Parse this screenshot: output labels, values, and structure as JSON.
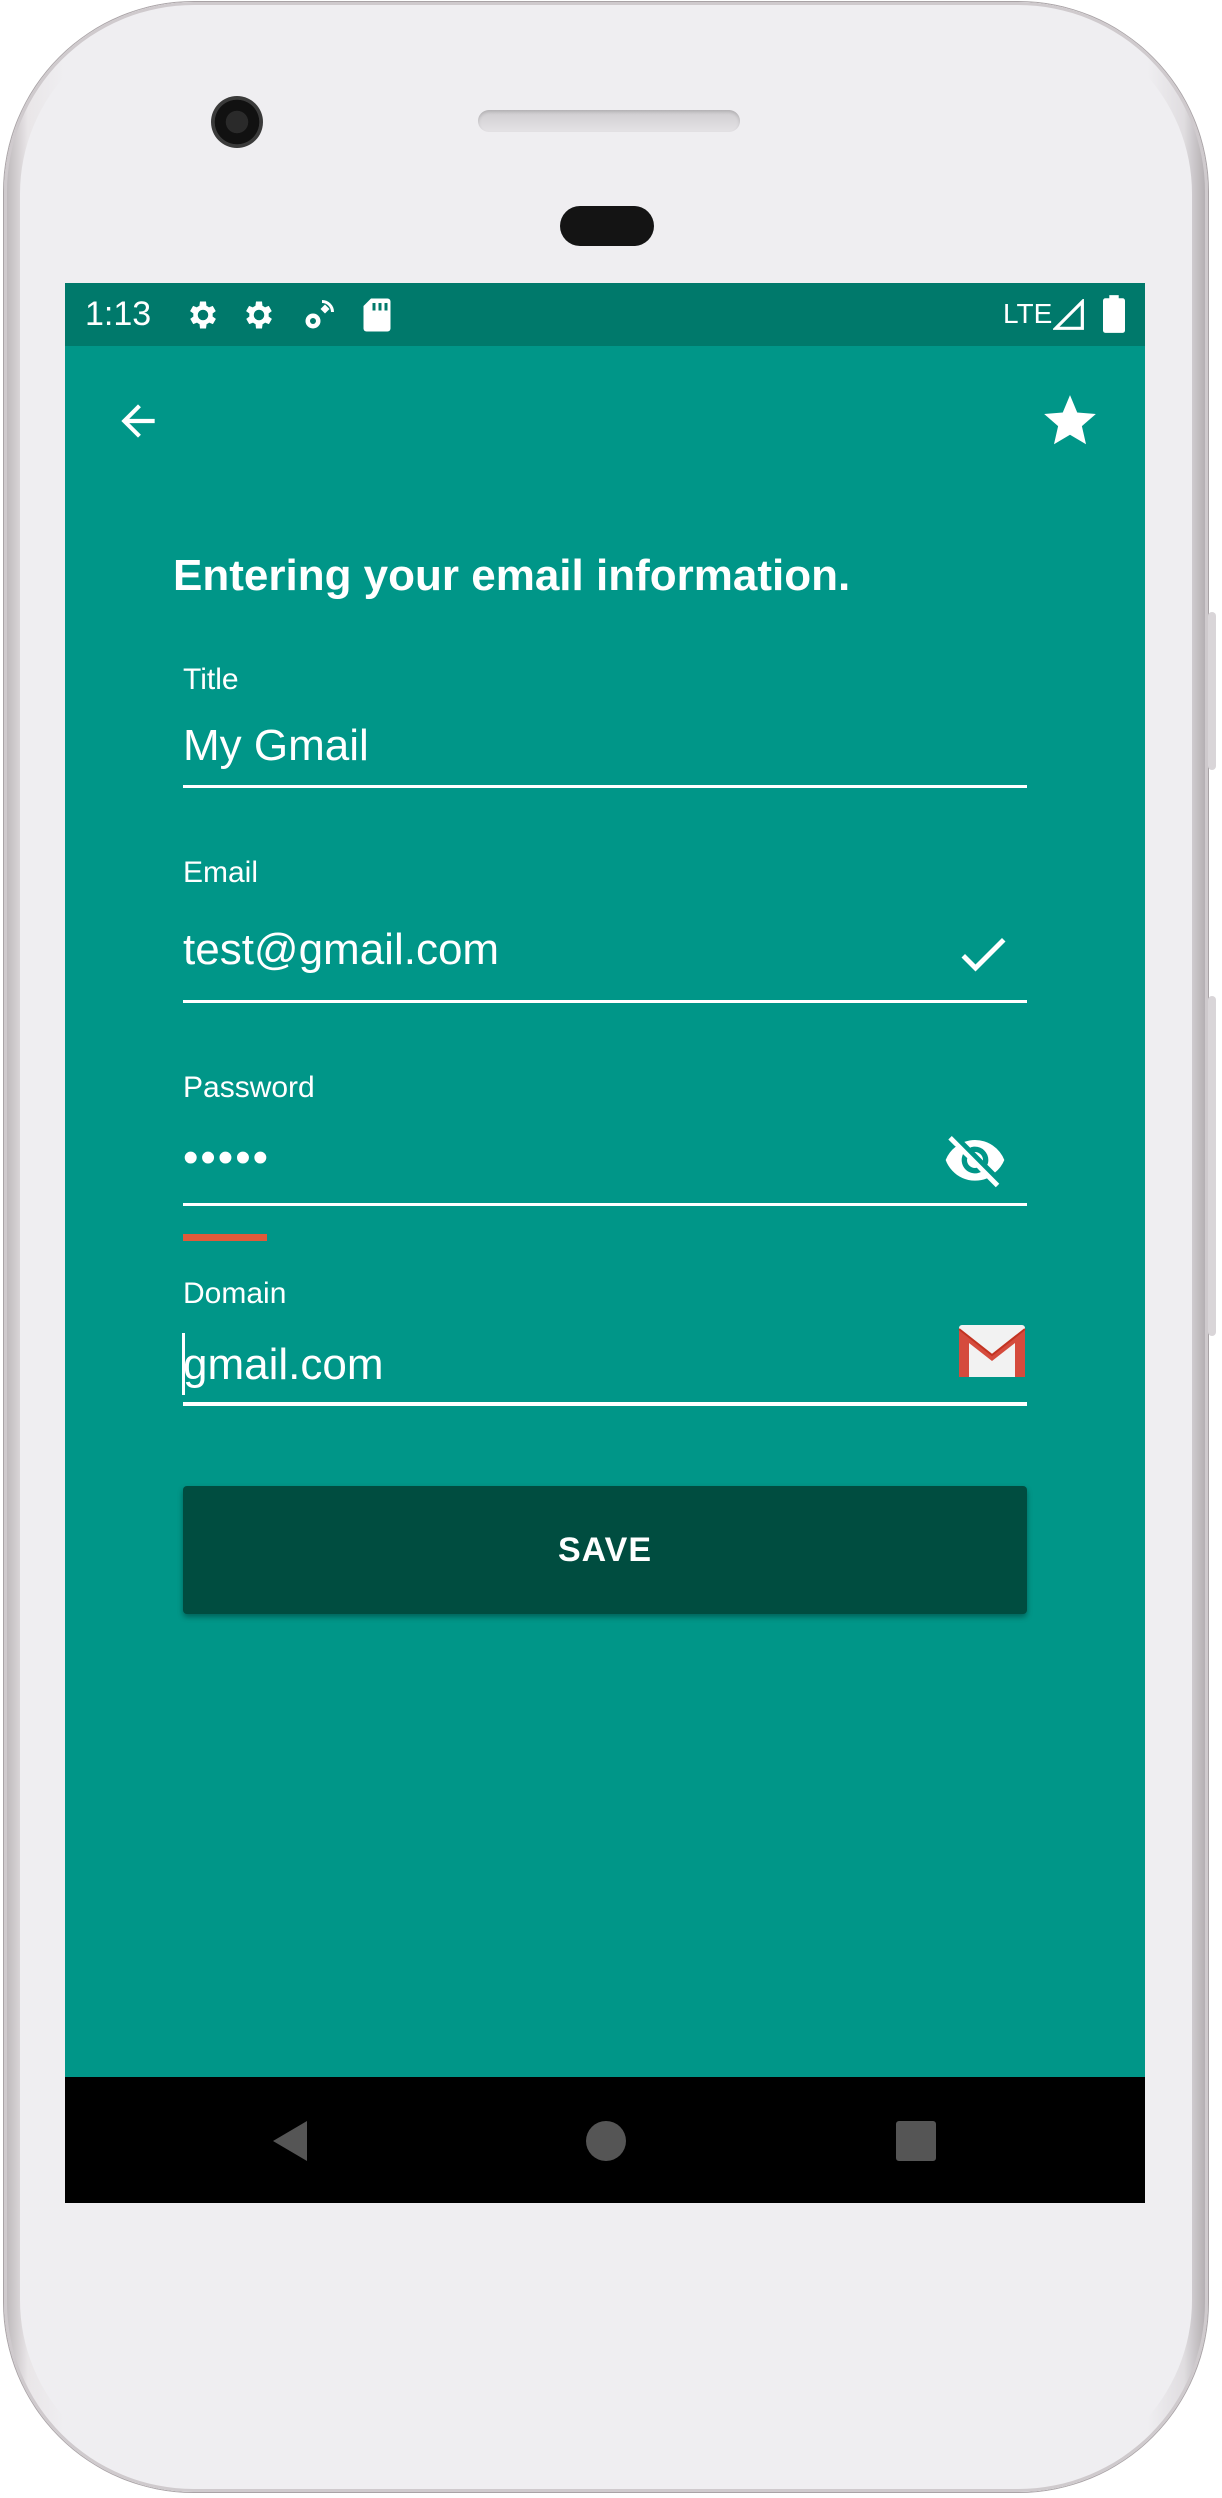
{
  "status_bar": {
    "time": "1:13",
    "network": "LTE",
    "icons": [
      "settings-icon",
      "settings-icon",
      "satellite-icon",
      "sd-card-icon",
      "signal-icon",
      "battery-icon"
    ]
  },
  "app_bar": {
    "back_icon": "arrow-back-icon",
    "favorite_icon": "star-icon"
  },
  "form": {
    "heading": "Entering your email information.",
    "title": {
      "label": "Title",
      "value": "My Gmail"
    },
    "email": {
      "label": "Email",
      "value": "test@gmail.com",
      "icon": "check-icon"
    },
    "password": {
      "label": "Password",
      "value": "•••••",
      "icon": "visibility-off-icon"
    },
    "domain": {
      "label": "Domain",
      "value": "gmail.com",
      "icon": "gmail-icon"
    },
    "save_label": "SAVE"
  },
  "nav_bar": {
    "back": "nav-back-icon",
    "home": "nav-home-icon",
    "recents": "nav-recents-icon"
  },
  "colors": {
    "background": "#009688",
    "status_bar": "#00796b",
    "button": "#004d40",
    "error": "#e05a3a"
  }
}
